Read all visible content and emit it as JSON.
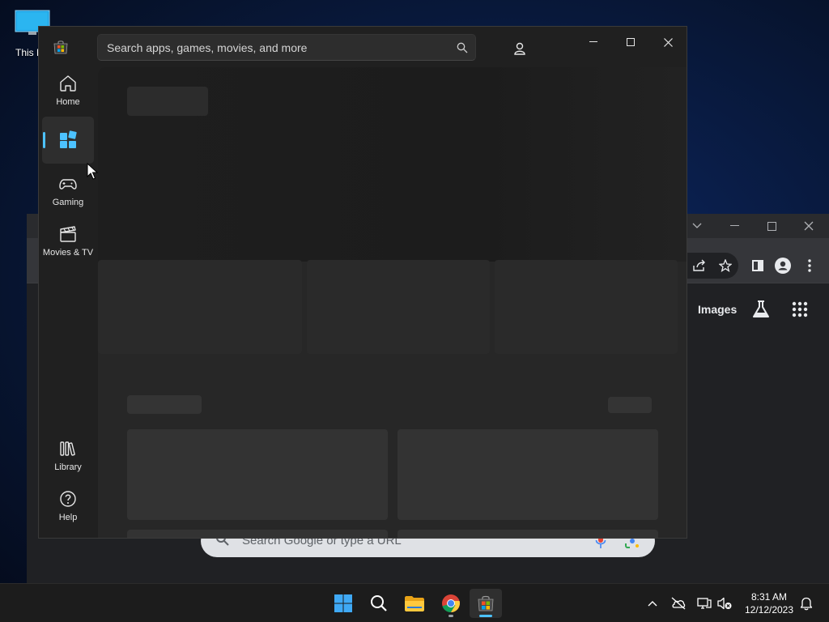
{
  "desktop": {
    "icon_label": "This P"
  },
  "chrome": {
    "nav_images": "Images",
    "search_placeholder": "Search Google or type a URL"
  },
  "store": {
    "search_placeholder": "Search apps, games, movies, and more",
    "nav_items": [
      {
        "name": "home",
        "label": "Home",
        "icon": "home-icon",
        "active": false
      },
      {
        "name": "apps",
        "label": "",
        "icon": "apps-icon",
        "active": true
      },
      {
        "name": "gaming",
        "label": "Gaming",
        "icon": "gamepad-icon",
        "active": false
      },
      {
        "name": "movies-tv",
        "label": "Movies & TV",
        "icon": "clapperboard-icon",
        "active": false
      }
    ],
    "bottom_nav": [
      {
        "name": "library",
        "label": "Library",
        "icon": "library-icon"
      },
      {
        "name": "help",
        "label": "Help",
        "icon": "help-icon"
      }
    ],
    "accent_color": "#4cc2ff"
  },
  "taskbar": {
    "apps": [
      "start",
      "search",
      "file-explorer",
      "chrome",
      "microsoft-store"
    ],
    "active_app": "microsoft-store",
    "time": "8:31 AM",
    "date": "12/12/2023"
  }
}
